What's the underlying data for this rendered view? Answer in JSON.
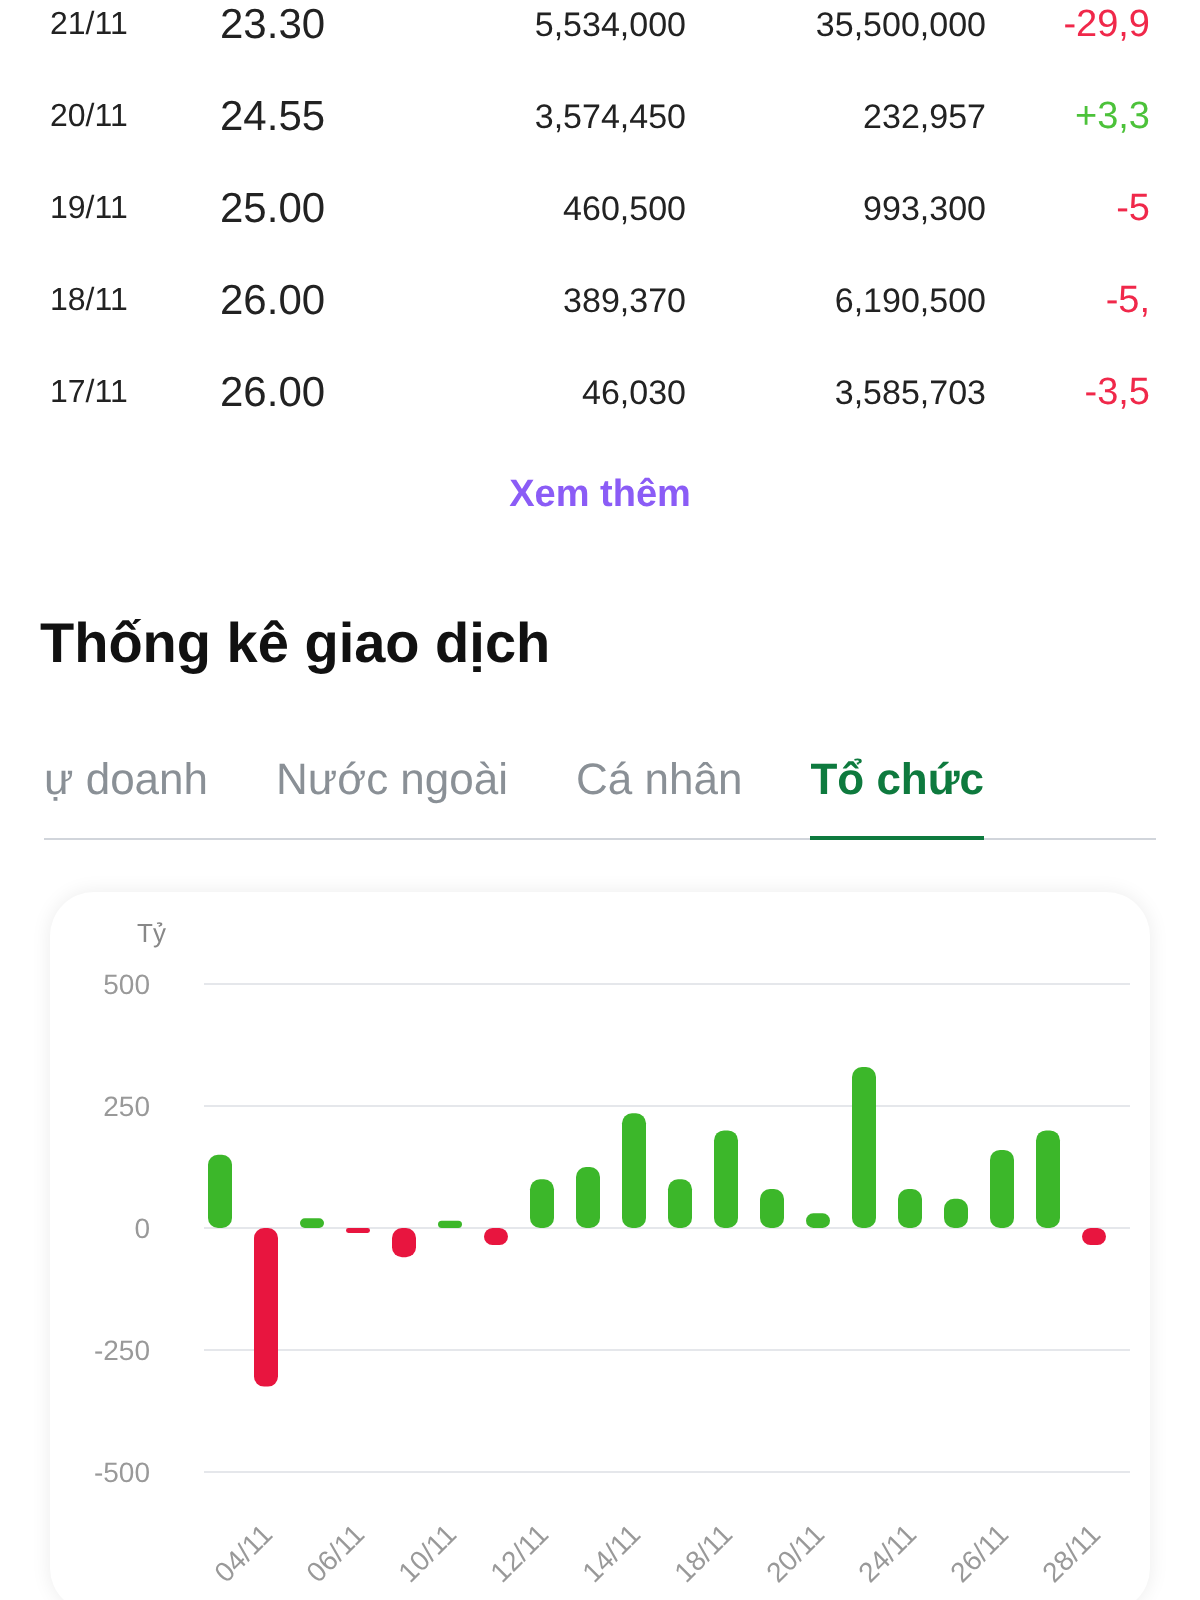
{
  "table": {
    "rows": [
      {
        "date": "21/11",
        "price": "23.30",
        "column_3": "5,534,000",
        "column_4": "35,500,000",
        "change": "-29,9",
        "color": "#f0284a"
      },
      {
        "date": "20/11",
        "price": "24.55",
        "column_3": "3,574,450",
        "column_4": "232,957",
        "change": "+3,3",
        "color": "#4cc23a"
      },
      {
        "date": "19/11",
        "price": "25.00",
        "column_3": "460,500",
        "column_4": "993,300",
        "change": "-5",
        "color": "#f0284a"
      },
      {
        "date": "18/11",
        "price": "26.00",
        "column_3": "389,370",
        "column_4": "6,190,500",
        "change": "-5,",
        "color": "#f0284a"
      },
      {
        "date": "17/11",
        "price": "26.00",
        "column_3": "46,030",
        "column_4": "3,585,703",
        "change": "-3,5",
        "color": "#f0284a"
      }
    ]
  },
  "more_link": "Xem thêm",
  "section_title": "Thống kê giao dịch",
  "tabs": [
    {
      "label": "ự doanh",
      "selected": false
    },
    {
      "label": "Nước ngoài",
      "selected": false
    },
    {
      "label": "Cá nhân",
      "selected": false
    },
    {
      "label": "Tổ chức",
      "selected": true
    }
  ],
  "chart_data": {
    "type": "bar",
    "ylabel": "Tỷ",
    "categories": [
      null,
      "04/11",
      null,
      "06/11",
      null,
      "10/11",
      null,
      "12/11",
      null,
      "14/11",
      null,
      "18/11",
      null,
      "20/11",
      null,
      "24/11",
      null,
      "26/11",
      null,
      "28/11"
    ],
    "series": [
      {
        "color": "#3cb72a",
        "values": [
          150,
          null,
          20,
          null,
          null,
          15,
          null,
          100,
          125,
          235,
          100,
          200,
          80,
          30,
          330,
          80,
          60,
          160,
          200,
          null
        ]
      },
      {
        "color": "#e8153f",
        "values": [
          null,
          -325,
          null,
          -10,
          -60,
          null,
          -35,
          null,
          null,
          null,
          null,
          null,
          null,
          null,
          null,
          null,
          null,
          null,
          null,
          -35
        ]
      }
    ],
    "ylim": [
      -500,
      500
    ],
    "yticks": [
      500,
      250,
      0,
      -250,
      -500
    ],
    "grid": true
  }
}
